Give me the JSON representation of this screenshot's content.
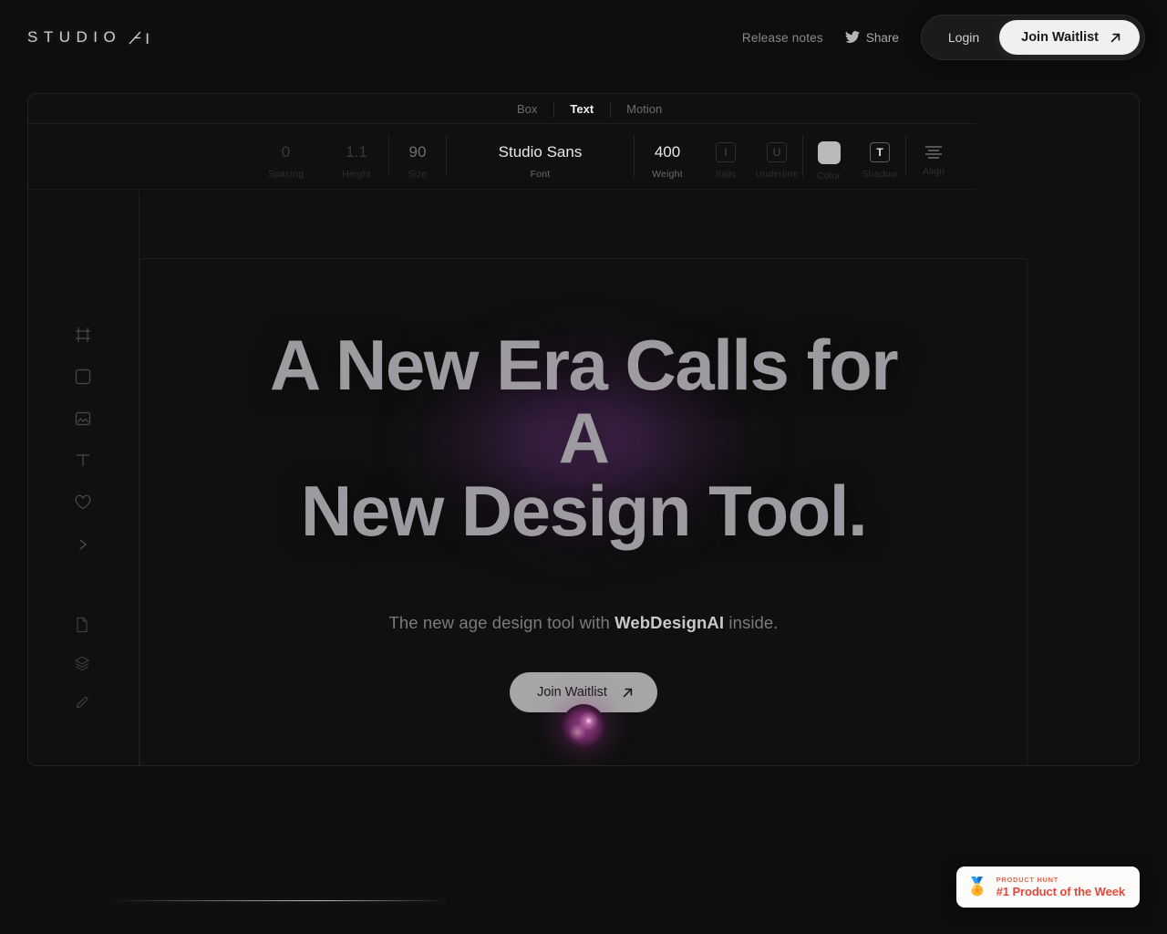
{
  "header": {
    "logo": "STUDIO",
    "logo_suffix": "AI",
    "release_notes": "Release notes",
    "share": "Share",
    "share_icon": "twitter-icon",
    "login": "Login",
    "join_waitlist": "Join Waitlist",
    "join_waitlist_icon": "arrow-up-right-icon"
  },
  "toolbar": {
    "tabs": [
      {
        "label": "Box",
        "active": false
      },
      {
        "label": "Text",
        "active": true
      },
      {
        "label": "Motion",
        "active": false
      }
    ],
    "fields": [
      {
        "value": "0",
        "label": "Spacing",
        "kind": "value",
        "state": "dim"
      },
      {
        "value": "1.1",
        "label": "Height",
        "kind": "value",
        "state": "dim"
      },
      {
        "value": "90",
        "label": "Size",
        "kind": "value",
        "state": "mid"
      },
      {
        "value": "Studio Sans",
        "label": "Font",
        "kind": "value",
        "state": "bright"
      },
      {
        "value": "400",
        "label": "Weight",
        "kind": "value",
        "state": "bright"
      },
      {
        "value": "I",
        "label": "Italic",
        "kind": "icon",
        "state": "dim"
      },
      {
        "value": "U",
        "label": "Underline",
        "kind": "icon",
        "state": "dim"
      },
      {
        "value": "",
        "label": "Color",
        "kind": "swatch",
        "state": "dim",
        "color": "#b9b9b9"
      },
      {
        "value": "T",
        "label": "Shadow",
        "kind": "icon",
        "state": "lit"
      },
      {
        "value": "",
        "label": "Align",
        "kind": "align",
        "state": "dim"
      }
    ]
  },
  "sidebar": {
    "top_tools": [
      {
        "icon": "frame-icon",
        "name": "frame-tool"
      },
      {
        "icon": "square-icon",
        "name": "shape-tool"
      },
      {
        "icon": "image-icon",
        "name": "image-tool"
      },
      {
        "icon": "text-icon",
        "name": "text-tool"
      },
      {
        "icon": "heart-icon",
        "name": "favorites-tool"
      },
      {
        "icon": "chevron-right-icon",
        "name": "expand-panel"
      }
    ],
    "bottom_tools": [
      {
        "icon": "page-icon",
        "name": "pages-tool"
      },
      {
        "icon": "layers-icon",
        "name": "layers-tool"
      },
      {
        "icon": "pen-icon",
        "name": "pen-tool"
      }
    ]
  },
  "hero": {
    "title_line1": "A New Era Calls for A",
    "title_line2": "New Design Tool.",
    "sub_before": "The new age design tool with ",
    "sub_bold": "WebDesignAI",
    "sub_after": " inside.",
    "cta": "Join Waitlist",
    "cta_icon": "arrow-up-right-icon",
    "orb_icon": "ai-orb-icon"
  },
  "product_hunt": {
    "medal": "🏅",
    "kicker": "PRODUCT HUNT",
    "title": "#1 Product of the Week"
  },
  "colors": {
    "background": "#0e0e0e",
    "panel": "#101010",
    "accent_glow": "#8e3d86",
    "cta_light": "#f2f0ee",
    "ph_red": "#e2483a"
  }
}
